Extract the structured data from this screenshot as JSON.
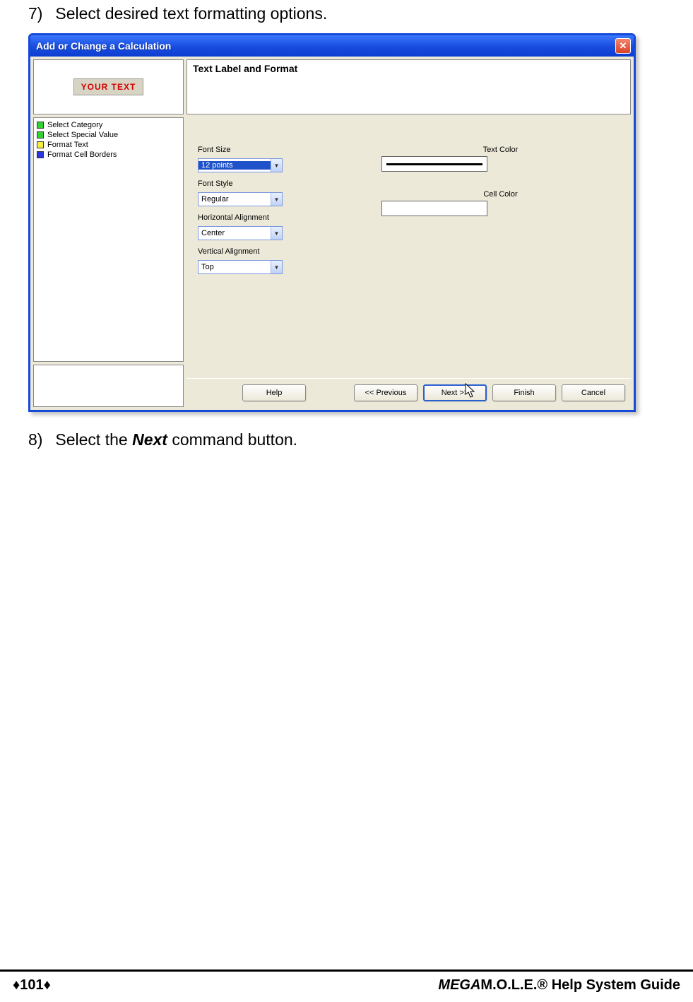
{
  "steps": {
    "s7_num": "7)",
    "s7_text": "Select desired text formatting options.",
    "s8_num": "8)",
    "s8_pre": "Select the ",
    "s8_bold": "Next",
    "s8_post": " command button."
  },
  "dialog": {
    "title": "Add or Change a Calculation",
    "close_x": "✕",
    "preview_text": "YOUR TEXT",
    "wizard_steps": [
      {
        "color": "green",
        "label": "Select Category"
      },
      {
        "color": "green",
        "label": "Select Special Value"
      },
      {
        "color": "yellow",
        "label": "Format Text"
      },
      {
        "color": "blue",
        "label": "Format Cell Borders"
      }
    ],
    "panel_title": "Text Label and Format",
    "fields": {
      "font_size_label": "Font Size",
      "font_size_value": "12 points",
      "font_style_label": "Font Style",
      "font_style_value": "Regular",
      "halign_label": "Horizontal Alignment",
      "halign_value": "Center",
      "valign_label": "Vertical Alignment",
      "valign_value": "Top",
      "text_color_label": "Text Color",
      "cell_color_label": "Cell Color"
    },
    "buttons": {
      "help": "Help",
      "prev": "<< Previous",
      "next": "Next >>",
      "finish": "Finish",
      "cancel": "Cancel"
    }
  },
  "footer": {
    "page": "♦101♦",
    "brand_it": "MEGA",
    "brand_rest": "M.O.L.E.® Help System Guide"
  }
}
